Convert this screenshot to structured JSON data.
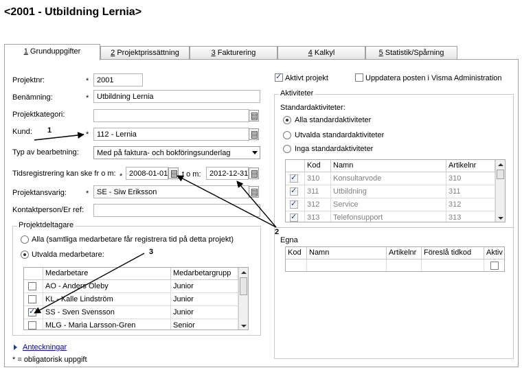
{
  "title": "<2001 - Utbildning Lernia>",
  "tabs": [
    {
      "key": "1",
      "label": " Grunduppgifter"
    },
    {
      "key": "2",
      "label": " Projektprissättning"
    },
    {
      "key": "3",
      "label": " Fakturering"
    },
    {
      "key": "4",
      "label": " Kalkyl"
    },
    {
      "key": "5",
      "label": " Statistik/Spårning"
    }
  ],
  "form": {
    "projektnr_label": "Projektnr:",
    "projektnr_value": "2001",
    "benamning_label": "Benämning:",
    "benamning_value": "Utbildning Lernia",
    "projektkategori_label": "Projektkategori:",
    "projektkategori_value": "",
    "kund_label": "Kund:",
    "kund_value": "112 - Lernia",
    "typ_label": "Typ av bearbetning:",
    "typ_value": "Med på faktura- och bokföringsunderlag",
    "tidsreg_label": "Tidsregistrering kan ske fr o m:",
    "tidsreg_from": "2008-01-01",
    "tom_label": "t o m:",
    "tidsreg_to": "2012-12-31",
    "ansvarig_label": "Projektansvarig:",
    "ansvarig_value": "SE - Siw Eriksson",
    "kontakt_label": "Kontaktperson/Er ref:",
    "kontakt_value": "",
    "required_mark": "*"
  },
  "deltagare": {
    "group_label": "Projektdeltagare",
    "radio_all": "Alla (samtliga medarbetare får registrera tid på detta projekt)",
    "radio_selected": "Utvalda medarbetare:",
    "col_medarbetare": "Medarbetare",
    "col_grupp": "Medarbetargrupp",
    "rows": [
      {
        "name": "AO - Anders Oleby",
        "group": "Junior",
        "checked": false
      },
      {
        "name": "KL - Kalle Lindström",
        "group": "Junior",
        "checked": false
      },
      {
        "name": "SS - Sven Svensson",
        "group": "Junior",
        "checked": true
      },
      {
        "name": "MLG - Maria Larsson-Gren",
        "group": "Senior",
        "checked": false
      }
    ]
  },
  "footer": {
    "anteckningar": "Anteckningar",
    "legend": "* = obligatorisk uppgift"
  },
  "right": {
    "aktivt_projekt": "Aktivt projekt",
    "uppdatera_visma": "Uppdatera posten i Visma Administration",
    "aktiviteter_label": "Aktiviteter",
    "standard_label": "Standardaktiviteter:",
    "radio_alla": "Alla standardaktiviteter",
    "radio_utvalda": "Utvalda standardaktiviteter",
    "radio_inga": "Inga standardaktiviteter",
    "col_kod": "Kod",
    "col_namn": "Namn",
    "col_artikelnr": "Artikelnr",
    "std_rows": [
      {
        "kod": "310",
        "namn": "Konsultarvode",
        "artikelnr": "310"
      },
      {
        "kod": "311",
        "namn": "Utbildning",
        "artikelnr": "311"
      },
      {
        "kod": "312",
        "namn": "Service",
        "artikelnr": "312"
      },
      {
        "kod": "313",
        "namn": "Telefonsupport",
        "artikelnr": "313"
      }
    ],
    "egna_label": "Egna",
    "egna_cols": [
      "Kod",
      "Namn",
      "Artikelnr",
      "Föreslå tidkod",
      "Aktiv"
    ]
  },
  "callouts": [
    "1",
    "2",
    "3"
  ]
}
